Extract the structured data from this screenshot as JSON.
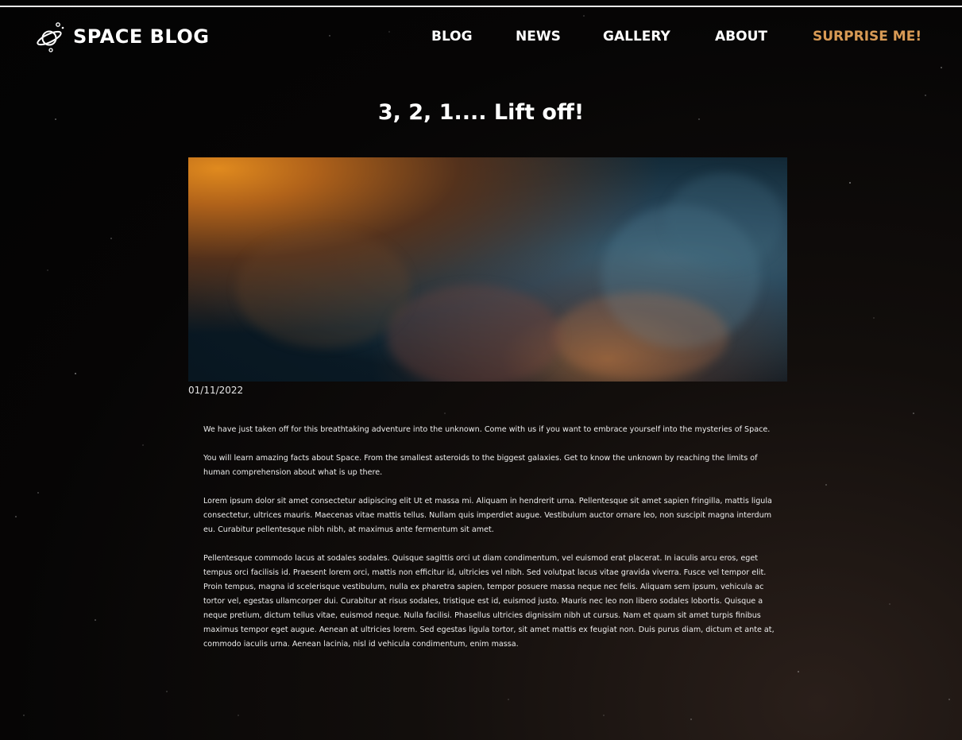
{
  "brand": {
    "title": "SPACE BLOG",
    "icon": "planet-icon"
  },
  "nav": {
    "items": [
      {
        "label": "BLOG"
      },
      {
        "label": "NEWS"
      },
      {
        "label": "GALLERY"
      },
      {
        "label": "ABOUT"
      },
      {
        "label": "SURPRISE ME!"
      }
    ]
  },
  "colors": {
    "accent": "#d89a55",
    "text": "#ffffff",
    "background": "#060505"
  },
  "post": {
    "title": "3, 2, 1.... Lift off!",
    "date": "01/11/2022",
    "paragraphs": [
      "We have just taken off for this breathtaking adventure into the unknown. Come with us if you want to embrace yourself into the mysteries of Space.",
      "You will learn amazing facts about Space. From the smallest asteroids to  the biggest galaxies. Get to know the unknown by reaching the limits of  human comprehension about what is up there.",
      "Lorem ipsum dolor sit amet consectetur adipiscing elit Ut et massa mi. Aliquam in hendrerit urna. Pellentesque sit amet sapien fringilla, mattis ligula consectetur, ultrices mauris. Maecenas vitae mattis tellus. Nullam quis imperdiet augue. Vestibulum auctor ornare leo, non suscipit magna interdum eu. Curabitur pellentesque nibh nibh, at maximus ante fermentum sit amet.",
      "Pellentesque commodo lacus at sodales sodales. Quisque sagittis orci ut diam condimentum, vel euismod erat placerat. In iaculis arcu eros, eget tempus orci facilisis id. Praesent lorem orci, mattis non efficitur id, ultricies vel nibh. Sed volutpat lacus vitae gravida viverra. Fusce vel tempor elit. Proin tempus, magna id scelerisque vestibulum, nulla ex pharetra sapien, tempor posuere massa neque nec felis. Aliquam sem ipsum, vehicula ac tortor vel, egestas ullamcorper dui. Curabitur at risus sodales, tristique est id, euismod justo. Mauris nec leo non libero sodales lobortis. Quisque a neque pretium, dictum tellus vitae, euismod neque. Nulla facilisi. Phasellus ultricies dignissim nibh ut cursus. Nam et quam sit amet turpis finibus maximus tempor eget augue. Aenean at ultricies lorem. Sed egestas ligula tortor, sit amet mattis ex feugiat non. Duis purus diam, dictum et ante at, commodo iaculis urna. Aenean lacinia, nisl id vehicula condimentum, enim massa."
    ]
  }
}
